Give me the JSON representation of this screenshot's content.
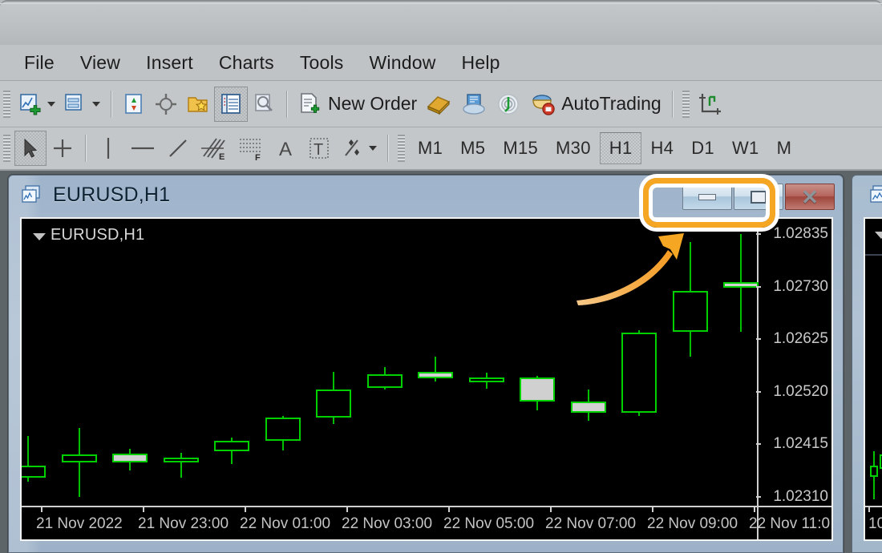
{
  "menubar": {
    "items": [
      "File",
      "View",
      "Insert",
      "Charts",
      "Tools",
      "Window",
      "Help"
    ]
  },
  "toolbar": {
    "new_order_label": "New Order",
    "autotrading_label": "AutoTrading",
    "icons": [
      "new-chart-icon",
      "chart-dropdown-caret",
      "profiles-icon",
      "profiles-dropdown-caret",
      "market-watch-icon",
      "navigator-icon",
      "data-window-icon",
      "terminal-icon",
      "strategy-tester-icon",
      "new-order-icon",
      "metaeditor-icon",
      "mql5-community-icon",
      "signals-icon",
      "autotrading-icon",
      "crosshair-axes-icon"
    ]
  },
  "linetools": {
    "icons": [
      "cursor-icon",
      "crosshair-icon",
      "vertical-line-icon",
      "horizontal-line-icon",
      "trendline-icon",
      "equidistant-channel-icon",
      "fibonacci-retracement-icon",
      "text-icon",
      "text-label-icon",
      "objects-icon",
      "objects-dropdown-caret"
    ],
    "timeframes": [
      "M1",
      "M5",
      "M15",
      "M30",
      "H1",
      "H4",
      "D1",
      "W1",
      "M"
    ],
    "active_timeframe": "H1"
  },
  "chart_window": {
    "title": "EURUSD,H1",
    "icon": "chart-window-icon",
    "minimize_label": "",
    "restore_label": "",
    "close_label": "✕",
    "chart_label": "EURUSD,H1"
  },
  "annotation": {
    "highlight_color": "#f5a623",
    "highlight_target": "minimize-and-restore-buttons",
    "arrow": "curved-up-right-arrow"
  },
  "chart_data": {
    "type": "candlestick",
    "title": "EURUSD,H1",
    "symbol": "EURUSD",
    "timeframe": "H1",
    "xlabel": "",
    "ylabel": "",
    "grid": false,
    "ylim": [
      1.0231,
      1.02835
    ],
    "price_ticks": [
      "1.02835",
      "1.02730",
      "1.02625",
      "1.02520",
      "1.02415",
      "1.02310"
    ],
    "time_ticks": [
      "21 Nov 2022",
      "21 Nov 23:00",
      "22 Nov 01:00",
      "22 Nov 03:00",
      "22 Nov 05:00",
      "22 Nov 07:00",
      "22 Nov 09:00",
      "22 Nov 11:0"
    ],
    "candles": [
      {
        "o": 1.02372,
        "h": 1.02432,
        "l": 1.0234,
        "c": 1.02348,
        "dir": "up"
      },
      {
        "o": 1.02378,
        "h": 1.02448,
        "l": 1.0231,
        "c": 1.02395,
        "dir": "up"
      },
      {
        "o": 1.02396,
        "h": 1.02406,
        "l": 1.02363,
        "c": 1.02378,
        "dir": "down"
      },
      {
        "o": 1.02378,
        "h": 1.02398,
        "l": 1.02348,
        "c": 1.02388,
        "dir": "up"
      },
      {
        "o": 1.024,
        "h": 1.02428,
        "l": 1.02375,
        "c": 1.02421,
        "dir": "up"
      },
      {
        "o": 1.02421,
        "h": 1.02471,
        "l": 1.02403,
        "c": 1.02468,
        "dir": "up"
      },
      {
        "o": 1.02468,
        "h": 1.0256,
        "l": 1.02455,
        "c": 1.02525,
        "dir": "up"
      },
      {
        "o": 1.02528,
        "h": 1.0257,
        "l": 1.02525,
        "c": 1.02555,
        "dir": "up"
      },
      {
        "o": 1.0256,
        "h": 1.0259,
        "l": 1.0254,
        "c": 1.02547,
        "dir": "down"
      },
      {
        "o": 1.02545,
        "h": 1.02558,
        "l": 1.02526,
        "c": 1.02549,
        "dir": "up"
      },
      {
        "o": 1.02549,
        "h": 1.02552,
        "l": 1.02482,
        "c": 1.025,
        "dir": "down"
      },
      {
        "o": 1.025,
        "h": 1.02524,
        "l": 1.02462,
        "c": 1.02478,
        "dir": "down"
      },
      {
        "o": 1.02478,
        "h": 1.02643,
        "l": 1.02472,
        "c": 1.02638,
        "dir": "up"
      },
      {
        "o": 1.0264,
        "h": 1.0282,
        "l": 1.0259,
        "c": 1.02722,
        "dir": "up"
      },
      {
        "o": 1.0274,
        "h": 1.02835,
        "l": 1.0264,
        "c": 1.02728,
        "dir": "down"
      }
    ]
  },
  "chart_window_2": {
    "icon": "chart-window-icon",
    "time_label": "10"
  }
}
